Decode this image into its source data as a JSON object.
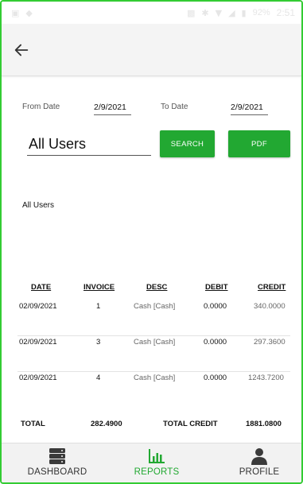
{
  "status_bar": {
    "battery": "92%",
    "time": "2:51"
  },
  "filters": {
    "from_label": "From Date",
    "from_value": "2/9/2021",
    "to_label": "To Date",
    "to_value": "2/9/2021",
    "user_value": "All Users",
    "search_label": "SEARCH",
    "pdf_label": "PDF"
  },
  "selected_user_caption": "All Users",
  "table": {
    "headers": [
      "DATE",
      "INVOICE",
      "DESC",
      "DEBIT",
      "CREDIT"
    ],
    "rows": [
      {
        "date": "02/09/2021",
        "invoice": "1",
        "desc": "Cash [Cash]",
        "debit": "0.0000",
        "credit": "340.0000"
      },
      {
        "date": "02/09/2021",
        "invoice": "3",
        "desc": "Cash [Cash]",
        "debit": "0.0000",
        "credit": "297.3600"
      },
      {
        "date": "02/09/2021",
        "invoice": "4",
        "desc": "Cash [Cash]",
        "debit": "0.0000",
        "credit": "1243.7200"
      }
    ]
  },
  "totals": {
    "label": "TOTAL",
    "debit_total": "282.4900",
    "credit_label": "TOTAL CREDIT",
    "credit_total": "1881.0800"
  },
  "bottom_nav": {
    "items": [
      {
        "label": "DASHBOARD",
        "icon": "server-stack-icon",
        "active": false
      },
      {
        "label": "REPORTS",
        "icon": "bar-chart-icon",
        "active": true
      },
      {
        "label": "PROFILE",
        "icon": "person-icon",
        "active": false
      }
    ]
  },
  "colors": {
    "accent": "#22a832",
    "frame": "#33cc33",
    "app_bar": "#f4f4f4"
  }
}
